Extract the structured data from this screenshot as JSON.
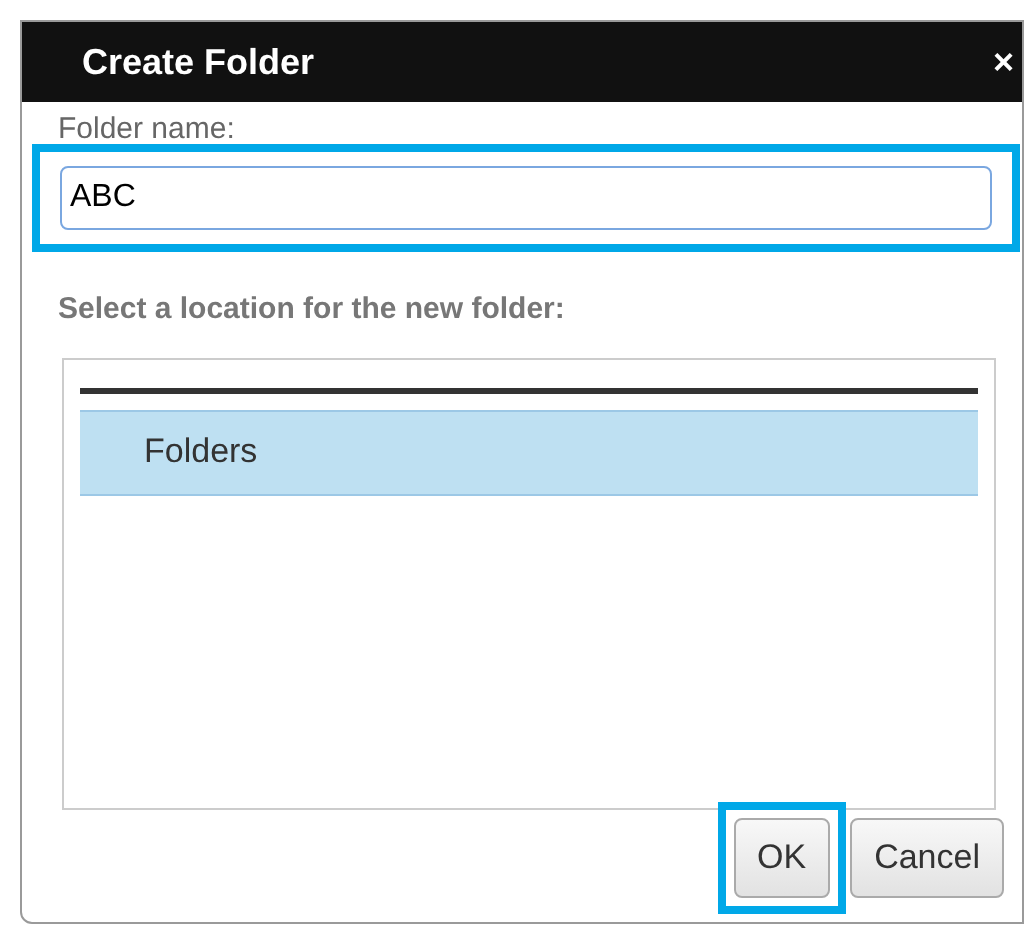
{
  "window": {
    "title": "Create Folder",
    "close": "×"
  },
  "name_field": {
    "label": "Folder name:",
    "value": "ABC",
    "highlighted": true
  },
  "location": {
    "label": "Select a location for the new folder:",
    "items": [
      {
        "label": "Folders",
        "selected": true
      }
    ]
  },
  "buttons": [
    {
      "label": "OK",
      "highlighted": true
    },
    {
      "label": "Cancel",
      "highlighted": false
    }
  ]
}
